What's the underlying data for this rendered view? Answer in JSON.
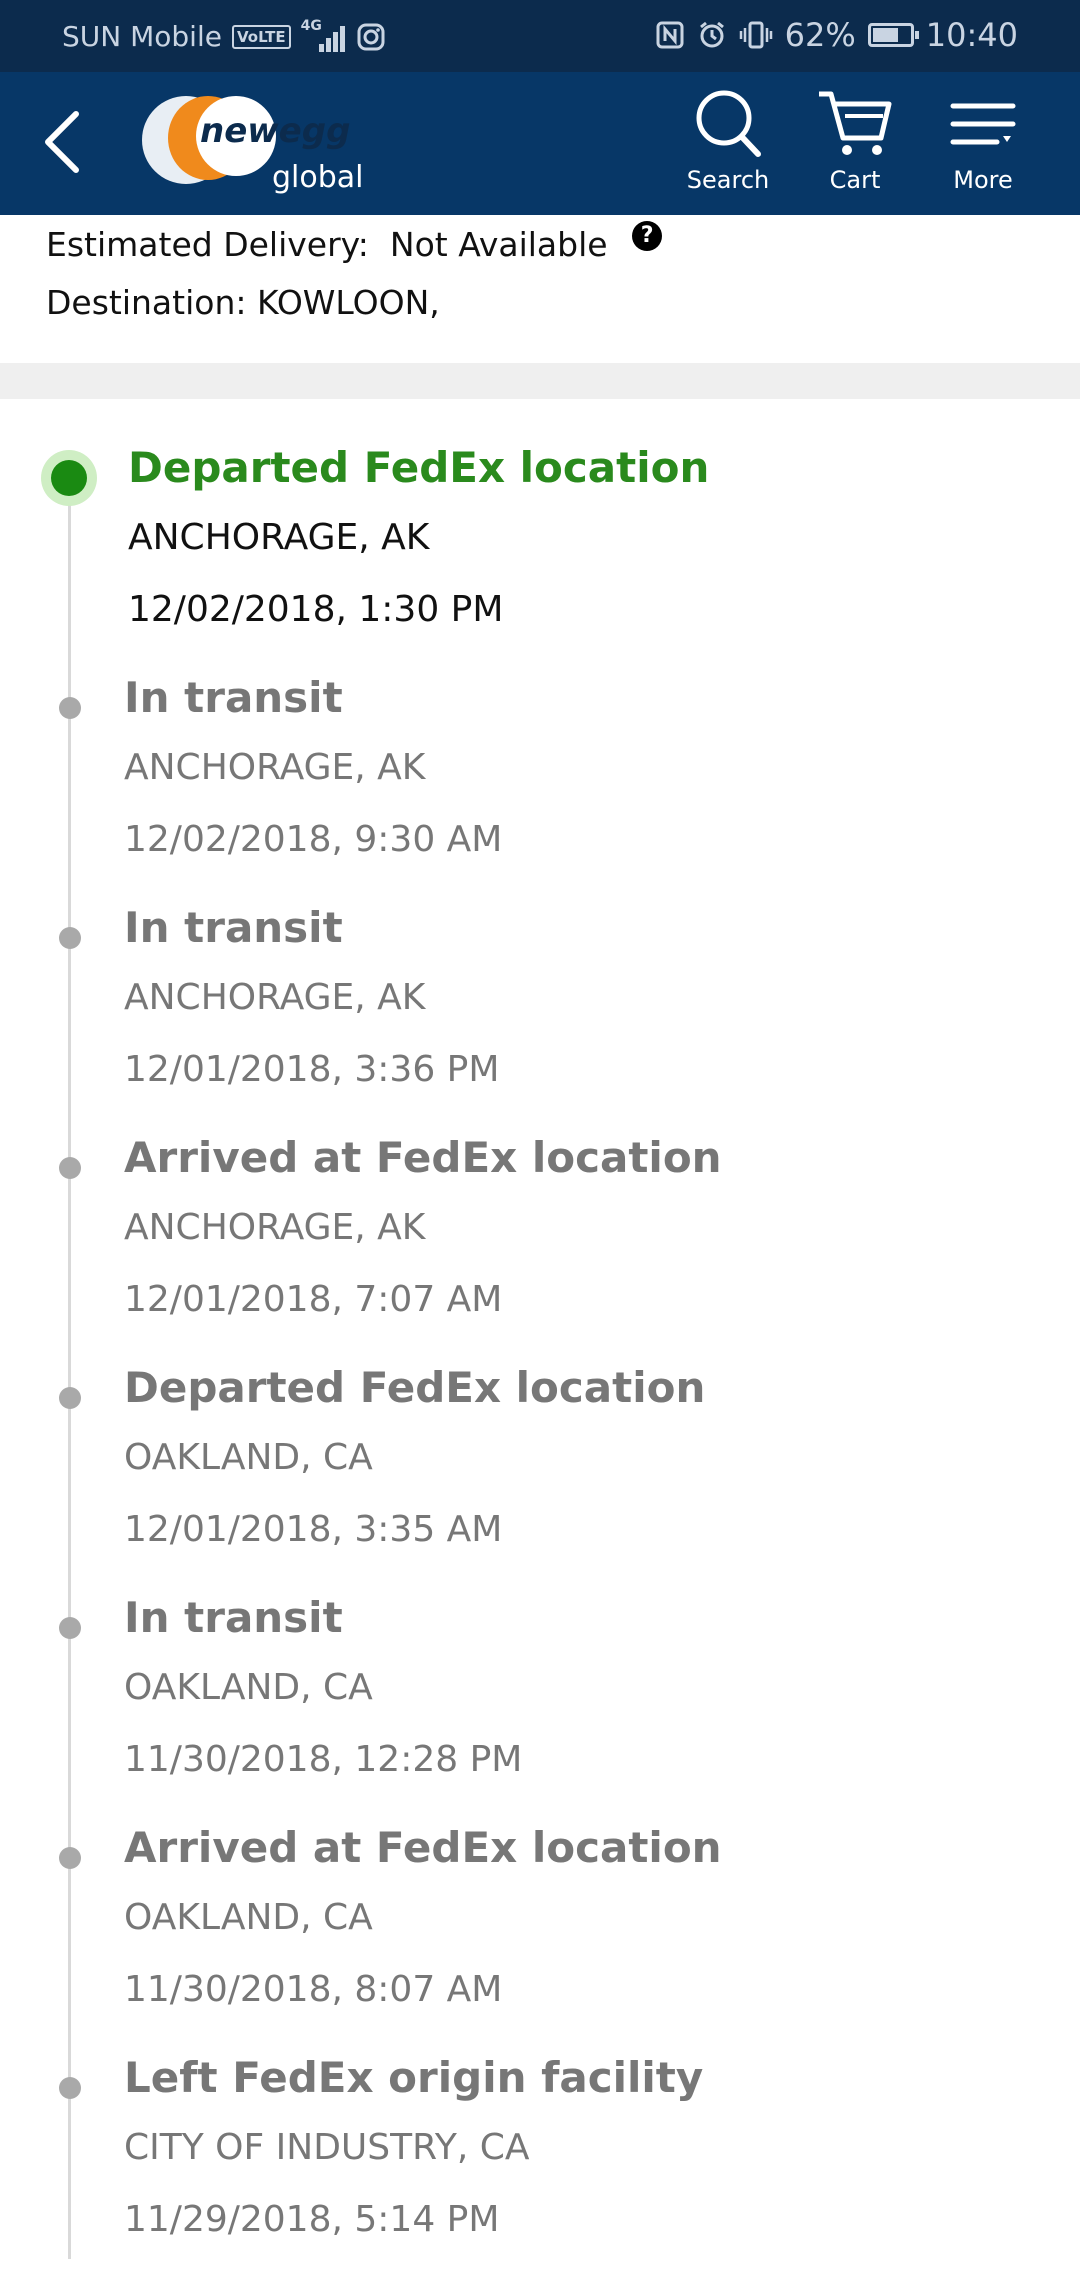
{
  "status_bar": {
    "carrier": "SUN Mobile",
    "volte_badge": "VoLTE",
    "network": "4G",
    "battery_percent": "62%",
    "battery_level": 0.62,
    "time": "10:40"
  },
  "nav": {
    "logo_main": "newegg",
    "logo_sub": "global",
    "search_label": "Search",
    "cart_label": "Cart",
    "more_label": "More"
  },
  "summary": {
    "estimated_delivery_label": "Estimated Delivery:",
    "estimated_delivery_value": "Not Available",
    "help_glyph": "?",
    "destination_label": "Destination:",
    "destination_value": "KOWLOON,"
  },
  "colors": {
    "status_bar_bg": "#0c2b4d",
    "nav_bg": "#073767",
    "current_event": "#2a8a1d",
    "past_event": "#777777"
  },
  "events": [
    {
      "title": "Departed FedEx location",
      "location": "ANCHORAGE, AK",
      "time": "12/02/2018, 1:30 PM",
      "current": true
    },
    {
      "title": "In transit",
      "location": "ANCHORAGE, AK",
      "time": "12/02/2018, 9:30 AM"
    },
    {
      "title": "In transit",
      "location": "ANCHORAGE, AK",
      "time": "12/01/2018, 3:36 PM"
    },
    {
      "title": "Arrived at FedEx location",
      "location": "ANCHORAGE, AK",
      "time": "12/01/2018, 7:07 AM"
    },
    {
      "title": "Departed FedEx location",
      "location": "OAKLAND, CA",
      "time": "12/01/2018, 3:35 AM"
    },
    {
      "title": "In transit",
      "location": "OAKLAND, CA",
      "time": "11/30/2018, 12:28 PM"
    },
    {
      "title": "Arrived at FedEx location",
      "location": "OAKLAND, CA",
      "time": "11/30/2018, 8:07 AM"
    },
    {
      "title": "Left FedEx origin facility",
      "location": "CITY OF INDUSTRY, CA",
      "time": "11/29/2018, 5:14 PM"
    }
  ]
}
